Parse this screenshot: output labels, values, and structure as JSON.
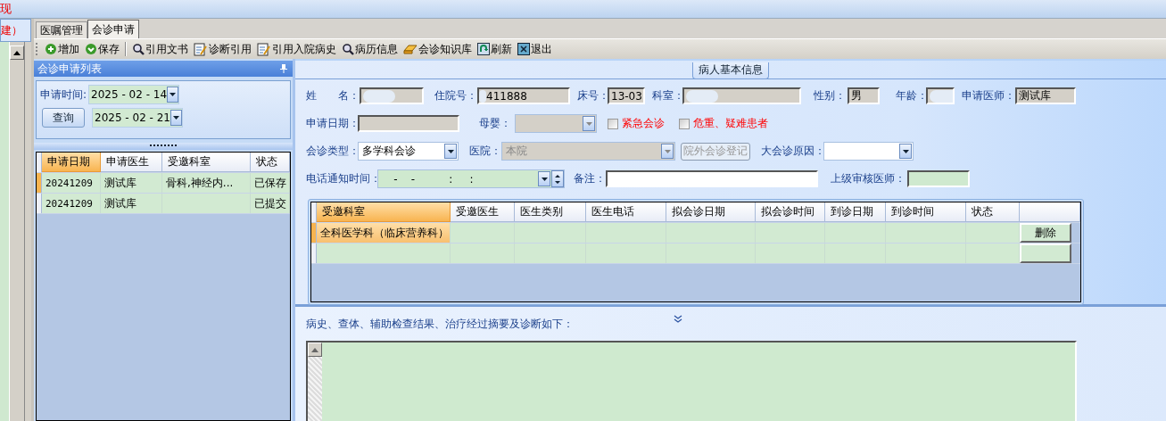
{
  "top_bar": {
    "text": "现"
  },
  "side_strip": {
    "text": "建）"
  },
  "tabs": [
    {
      "label": "医嘱管理",
      "selected": false
    },
    {
      "label": "会诊申请",
      "selected": true
    }
  ],
  "toolbar": [
    "增加",
    "保存",
    "引用文书",
    "诊断引用",
    "引用入院病史",
    "病历信息",
    "会诊知识库",
    "刷新",
    "退出"
  ],
  "list_panel": {
    "title": "会诊申请列表",
    "query": {
      "time_label": "申请时间:",
      "from": "2025 - 02 - 14",
      "to": "2025 - 02 - 21",
      "button": "查询"
    },
    "columns": [
      {
        "label": "申请日期",
        "selected": true
      },
      {
        "label": "申请医生",
        "selected": false
      },
      {
        "label": "受邀科室",
        "selected": false
      },
      {
        "label": "状态",
        "selected": false
      }
    ],
    "rows": [
      {
        "selected": true,
        "cells": [
          "20241209",
          "测试库",
          "骨科,神经内...",
          "已保存"
        ]
      },
      {
        "selected": false,
        "cells": [
          "20241209",
          "测试库",
          "",
          "已提交"
        ]
      }
    ]
  },
  "patient_info": {
    "title": "病人基本信息",
    "lines": [
      {
        "items": [
          {
            "kind": "text",
            "label": "姓　　名：",
            "masked": true,
            "readonly": true
          },
          {
            "kind": "text",
            "label": "住院号：",
            "value": "411888",
            "masked": true,
            "readonly": true
          },
          {
            "kind": "text",
            "label": "床号：",
            "value": "13-03",
            "readonly": true
          },
          {
            "kind": "text",
            "label": "科室：",
            "masked": true,
            "readonly": true
          },
          {
            "kind": "text",
            "label": "性别：",
            "value": "男",
            "readonly": true
          },
          {
            "kind": "text",
            "label": "年龄：",
            "masked": true,
            "readonly": true
          },
          {
            "kind": "text",
            "label": "申请医师：",
            "value": "测试库",
            "readonly": true
          }
        ]
      },
      {
        "items": [
          {
            "kind": "text",
            "label": "申请日期：",
            "readonly": true
          },
          {
            "kind": "combo",
            "label": "母婴：",
            "disabled": true
          },
          {
            "kind": "check",
            "label": "紧急会诊",
            "checked": false
          },
          {
            "kind": "check",
            "label": "危重、疑难患者",
            "checked": false
          }
        ]
      },
      {
        "items": [
          {
            "kind": "combo",
            "label": "会诊类型：",
            "value": "多学科会诊",
            "disabled": false
          },
          {
            "kind": "combo",
            "label": "医院：",
            "value": "本院",
            "disabled": true
          },
          {
            "kind": "button",
            "label": "院外会诊登记",
            "disabled": true
          },
          {
            "kind": "combo",
            "label": "大会诊原因：",
            "disabled": false
          }
        ]
      },
      {
        "items": [
          {
            "kind": "time",
            "label": "电话通知时间：",
            "value": "    -    -          :     :"
          },
          {
            "kind": "text",
            "label": "备注：",
            "readonly": false
          },
          {
            "kind": "text",
            "label": "上级审核医师：",
            "readonly": false,
            "green": true
          }
        ]
      }
    ]
  },
  "invite_table": {
    "columns": [
      {
        "label": "受邀科室",
        "selected": true
      },
      {
        "label": "受邀医生",
        "selected": false
      },
      {
        "label": "医生类别",
        "selected": false
      },
      {
        "label": "医生电话",
        "selected": false
      },
      {
        "label": "拟会诊日期",
        "selected": false
      },
      {
        "label": "拟会诊时间",
        "selected": false
      },
      {
        "label": "到诊日期",
        "selected": false
      },
      {
        "label": "到诊时间",
        "selected": false
      },
      {
        "label": "状态",
        "selected": false
      }
    ],
    "rows": [
      {
        "selected": true,
        "cells": [
          "全科医学科（临床营养科）",
          "",
          "",
          "",
          "",
          "",
          "",
          "",
          ""
        ],
        "action": "删除"
      },
      {
        "selected": false,
        "cells": [
          "",
          "",
          "",
          "",
          "",
          "",
          "",
          "",
          ""
        ]
      }
    ]
  },
  "history": {
    "label": "病史、查体、辅助检查结果、治疗经过摘要及诊断如下："
  }
}
